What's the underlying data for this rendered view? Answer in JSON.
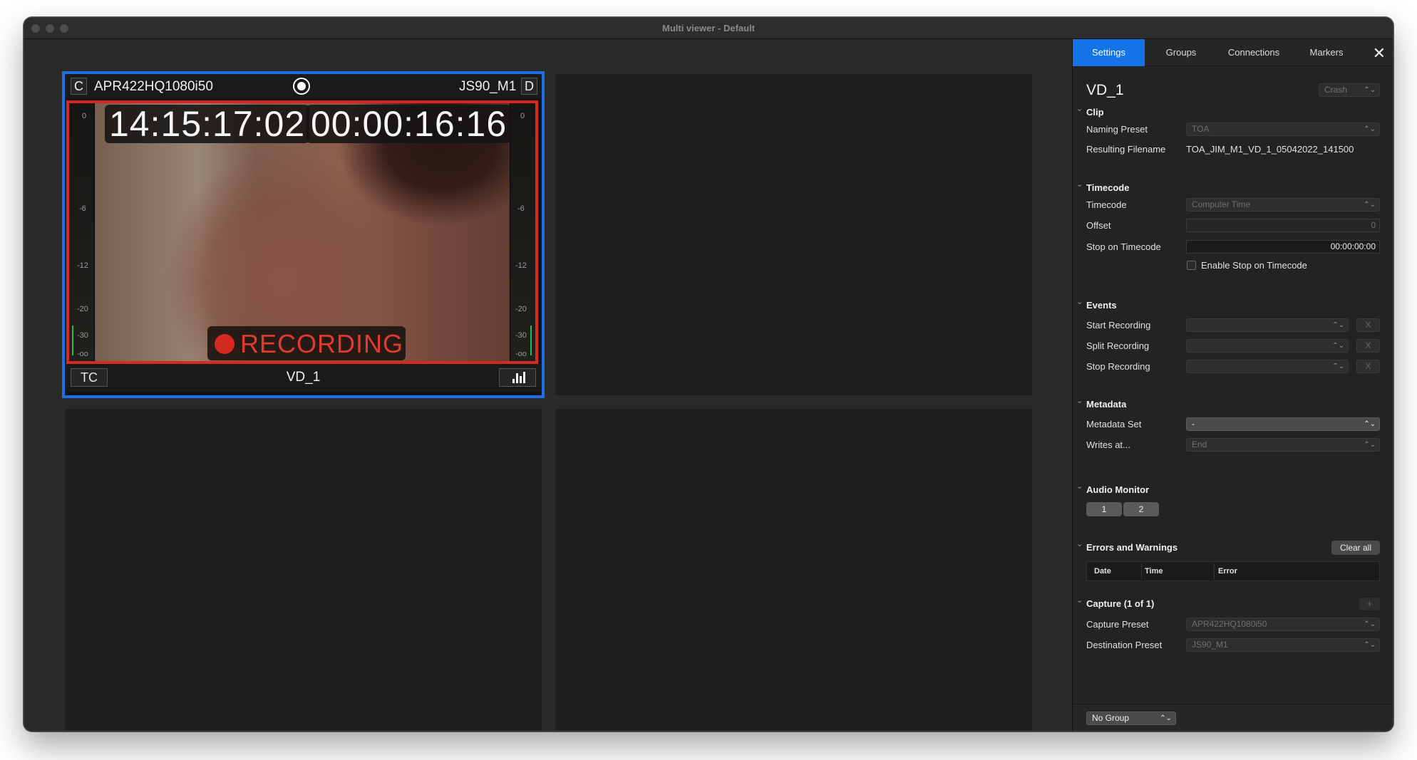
{
  "window": {
    "title": "Multi viewer - Default"
  },
  "viewer": {
    "active_tile": {
      "left_letter": "C",
      "capture_preset": "APR422HQ1080i50",
      "destination": "JS90_M1",
      "right_letter": "D",
      "timecode_1": "14:15:17:02",
      "timecode_2": "00:00:16:16",
      "recording_label": "RECORDING",
      "footer_tc": "TC",
      "footer_name": "VD_1",
      "meter_ticks": [
        "0",
        "-6",
        "-12",
        "-20",
        "-30",
        "-oo"
      ]
    }
  },
  "panel": {
    "tabs": [
      "Settings",
      "Groups",
      "Connections",
      "Markers"
    ],
    "device_name": "VD_1",
    "crash_label": "Crash",
    "clip": {
      "title": "Clip",
      "naming_preset_label": "Naming Preset",
      "naming_preset_value": "TOA",
      "resulting_filename_label": "Resulting Filename",
      "resulting_filename_value": "TOA_JIM_M1_VD_1_05042022_141500"
    },
    "timecode": {
      "title": "Timecode",
      "timecode_label": "Timecode",
      "timecode_value": "Computer Time",
      "offset_label": "Offset",
      "offset_value": "0",
      "stop_label": "Stop on Timecode",
      "stop_value": "00:00:00:00",
      "enable_stop_label": "Enable Stop on Timecode"
    },
    "events": {
      "title": "Events",
      "start_label": "Start Recording",
      "split_label": "Split Recording",
      "stop_label": "Stop Recording",
      "clear_x": "X"
    },
    "metadata": {
      "title": "Metadata",
      "set_label": "Metadata Set",
      "set_value": "-",
      "writes_label": "Writes at...",
      "writes_value": "End"
    },
    "audio": {
      "title": "Audio Monitor",
      "channels": [
        "1",
        "2"
      ]
    },
    "errors": {
      "title": "Errors and Warnings",
      "clear_all": "Clear all",
      "columns": [
        "Date",
        "Time",
        "Error"
      ]
    },
    "capture": {
      "title": "Capture (1 of 1)",
      "add": "+",
      "preset_label": "Capture Preset",
      "preset_value": "APR422HQ1080i50",
      "destination_label": "Destination Preset",
      "destination_value": "JS90_M1"
    },
    "group_select": "No Group"
  },
  "colors": {
    "accent": "#1473e6",
    "active_border": "#1e6fe8",
    "recording": "#d42a1f"
  }
}
